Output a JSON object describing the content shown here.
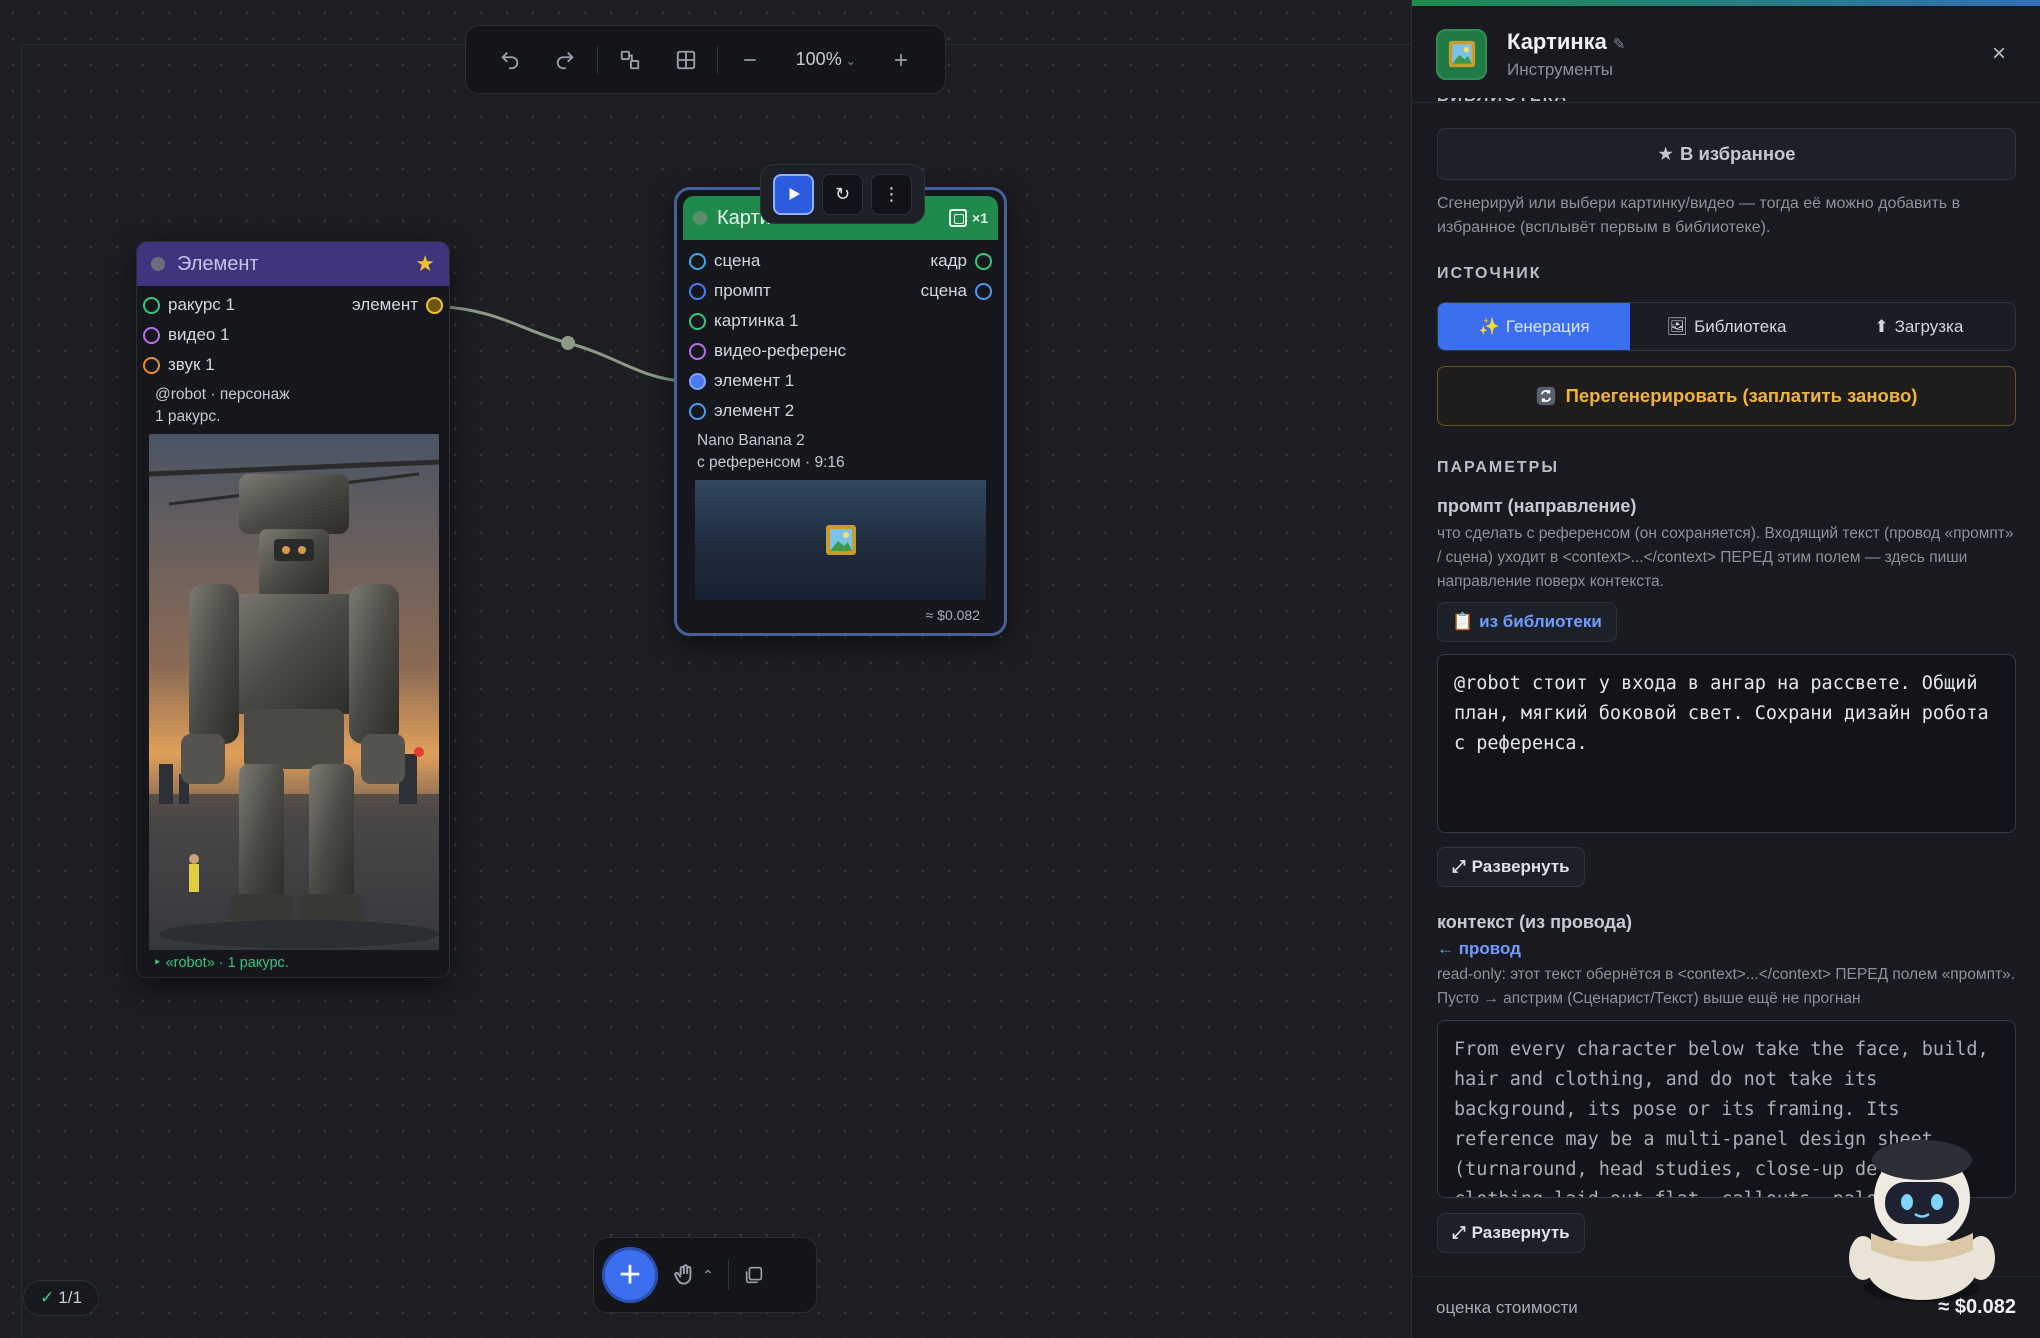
{
  "toolbar": {
    "zoom": "100%"
  },
  "element_node": {
    "title": "Элемент",
    "inputs": [
      {
        "label": "ракурс 1",
        "color": "#34c77b"
      },
      {
        "label": "видео 1",
        "color": "#b46ee8"
      },
      {
        "label": "звук 1",
        "color": "#f08a2b"
      }
    ],
    "output": {
      "label": "элемент",
      "color": "#f2c230"
    },
    "note_line1": "@robot · персонаж",
    "note_line2": "1 ракурс.",
    "footer": "‣ «robot» · 1 ракурс."
  },
  "picture_node": {
    "title": "Картинка",
    "copies": "×1",
    "inputs": [
      {
        "label": "сцена",
        "color": "#37a8e6",
        "right": "кадр",
        "right_color": "#34c77b"
      },
      {
        "label": "промпт",
        "color": "#4a7cf0",
        "right": "сцена",
        "right_color": "#4a9af0"
      },
      {
        "label": "картинка 1",
        "color": "#34c77b"
      },
      {
        "label": "видео-референс",
        "color": "#b46ee8"
      },
      {
        "label": "элемент 1",
        "color": "#7aa3ff",
        "filled": true
      },
      {
        "label": "элемент 2",
        "color": "#4a9af0"
      }
    ],
    "model_line1": "Nano Banana 2",
    "model_line2": "с референсом · 9:16",
    "price": "≈ $0.082"
  },
  "status": {
    "text": "1/1"
  },
  "panel": {
    "title": "Картинка",
    "subtitle": "Инструменты",
    "library_section_cut": "БИБЛИОТЕКА",
    "fav_button": "В избранное",
    "fav_hint": "Сгенерируй или выбери картинку/видео — тогда её можно добавить в избранное (всплывёт первым в библиотеке).",
    "source_label": "ИСТОЧНИК",
    "source_tabs": [
      {
        "label": "Генерация",
        "icon": "✨",
        "active": true
      },
      {
        "label": "Библиотека",
        "icon": "🖼",
        "active": false
      },
      {
        "label": "Загрузка",
        "icon": "⬆",
        "active": false
      }
    ],
    "regen_button": "Перегенерировать (заплатить заново)",
    "params_label": "ПАРАМЕТРЫ",
    "prompt_label": "промпт (направление)",
    "prompt_hint": "что сделать с референсом (он сохраняется). Входящий текст (провод «промпт» / сцена) уходит в <context>...</context> ПЕРЕД этим полем — здесь пиши направление поверх контекста.",
    "from_library_button": "из библиотеки",
    "prompt_text": "@robot стоит у входа в ангар на рассвете. Общий план, мягкий боковой свет. Сохрани дизайн робота с референса.",
    "expand_button": "Развернуть",
    "context_label": "контекст (из провода)",
    "context_link": "← провод",
    "context_hint": "read-only: этот текст обернётся в <context>...</context> ПЕРЕД полем «промпт». Пусто → апстрим (Сценарист/Текст) выше ещё не прогнан",
    "context_text": "From every character below take the face, build, hair and clothing, and do not take its background, its pose or its framing. Its reference may be a multi-panel design sheet (turnaround, head studies, close-up details, clothing laid out flat, callouts, palette",
    "expand_button_2": "Развернуть",
    "cost_label": "оценка стоимости",
    "cost_value": "≈ $0.082"
  }
}
